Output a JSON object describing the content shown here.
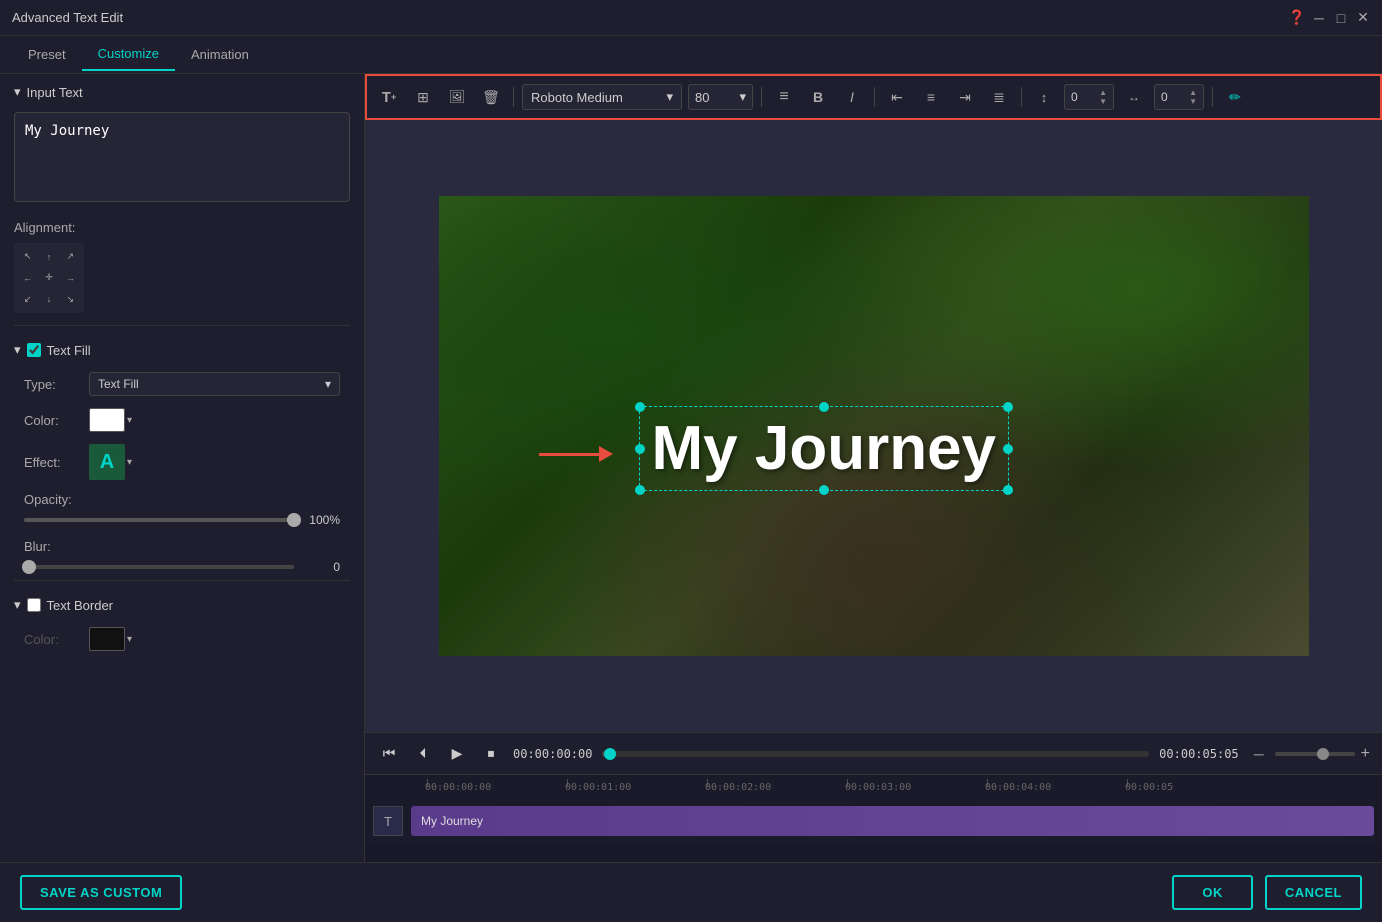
{
  "titleBar": {
    "title": "Advanced Text Edit",
    "helpIcon": "❓",
    "minimizeIcon": "─",
    "maximizeIcon": "□",
    "closeIcon": "✕"
  },
  "tabs": {
    "preset": "Preset",
    "customize": "Customize",
    "animation": "Animation"
  },
  "leftPanel": {
    "inputTextSection": {
      "label": "Input Text",
      "value": "My Journey"
    },
    "alignment": {
      "label": "Alignment:"
    },
    "textFill": {
      "label": "Text Fill",
      "typeLabel": "Type:",
      "typeValue": "Text Fill",
      "colorLabel": "Color:",
      "effectLabel": "Effect:",
      "effectChar": "A"
    },
    "opacity": {
      "label": "Opacity:",
      "value": "100%",
      "sliderPercent": 100
    },
    "blur": {
      "label": "Blur:",
      "value": "0",
      "sliderPercent": 0
    },
    "textBorder": {
      "label": "Text Border",
      "colorLabel": "Color:"
    }
  },
  "toolbar": {
    "addTextBtn": "T+",
    "transformBtn": "⊞",
    "imageBtn": "🖼",
    "deleteBtn": "🗑",
    "fontName": "Roboto Medium",
    "fontSize": "80",
    "boldBtn": "B",
    "italicBtn": "I",
    "alignLeft": "≡",
    "alignCenter": "≡",
    "alignRight": "≡",
    "alignJustify": "≡",
    "spacingIcon": "↔",
    "spacingValue": "0",
    "kerningIcon": "⇔",
    "kerningValue": "0",
    "penIcon": "✏"
  },
  "canvas": {
    "overlayText": "My Journey",
    "arrowLabel": "→"
  },
  "playback": {
    "rewindBtn": "⏮",
    "backBtn": "⏴",
    "playBtn": "▶",
    "stopBtn": "⏹",
    "currentTime": "00:00:00:00",
    "endTime": "00:00:05:05",
    "zoomMinusBtn": "─",
    "zoomPlusBtn": "+"
  },
  "timeline": {
    "rulerMarks": [
      "00:00:00:00",
      "00:00:01:00",
      "00:00:02:00",
      "00:00:03:00",
      "00:00:04:00",
      "00:00:05"
    ],
    "trackIcon": "T",
    "trackLabel": "My Journey"
  },
  "bottomBar": {
    "saveCustomBtn": "SAVE AS CUSTOM",
    "okBtn": "OK",
    "cancelBtn": "CANCEL"
  }
}
